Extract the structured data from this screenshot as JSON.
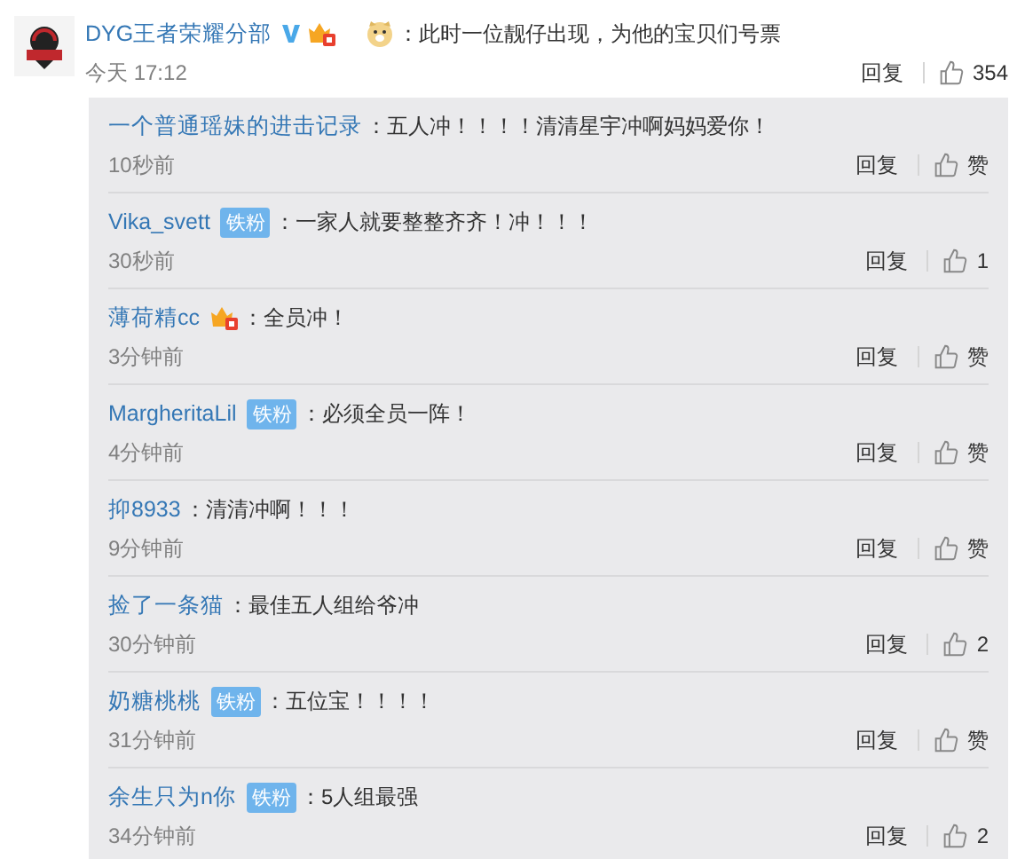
{
  "comment": {
    "user": "DYG王者荣耀分部",
    "verified": true,
    "crown": true,
    "emoji": true,
    "text": "：此时一位靓仔出现，为他的宝贝们号票",
    "time": "今天 17:12",
    "reply_label": "回复",
    "likes": "354"
  },
  "replies": [
    {
      "user": "一个普通瑶妹的进击记录",
      "text": "：五人冲！！！！清清星宇冲啊妈妈爱你！",
      "time": "10秒前",
      "reply_label": "回复",
      "likes": "赞"
    },
    {
      "user": "Vika_svett",
      "badge": {
        "kind": "fan",
        "label": "铁粉"
      },
      "text": "：一家人就要整整齐齐！冲！！！",
      "time": "30秒前",
      "reply_label": "回复",
      "likes": "1"
    },
    {
      "user": "薄荷精cc",
      "badge": {
        "kind": "crown"
      },
      "text": "：全员冲！",
      "time": "3分钟前",
      "reply_label": "回复",
      "likes": "赞"
    },
    {
      "user": "MargheritaLil",
      "badge": {
        "kind": "fan",
        "label": "铁粉"
      },
      "text": "：必须全员一阵！",
      "time": "4分钟前",
      "reply_label": "回复",
      "likes": "赞"
    },
    {
      "user": "抑8933",
      "text": "：清清冲啊！！！",
      "time": "9分钟前",
      "reply_label": "回复",
      "likes": "赞"
    },
    {
      "user": "捡了一条猫",
      "text": "：最佳五人组给爷冲",
      "time": "30分钟前",
      "reply_label": "回复",
      "likes": "2"
    },
    {
      "user": "奶糖桃桃",
      "badge": {
        "kind": "fan",
        "label": "铁粉"
      },
      "text": "：五位宝！！！！",
      "time": "31分钟前",
      "reply_label": "回复",
      "likes": "赞"
    },
    {
      "user": "余生只为n你",
      "badge": {
        "kind": "fan",
        "label": "铁粉"
      },
      "text": "：5人组最强",
      "time": "34分钟前",
      "reply_label": "回复",
      "likes": "2"
    }
  ]
}
